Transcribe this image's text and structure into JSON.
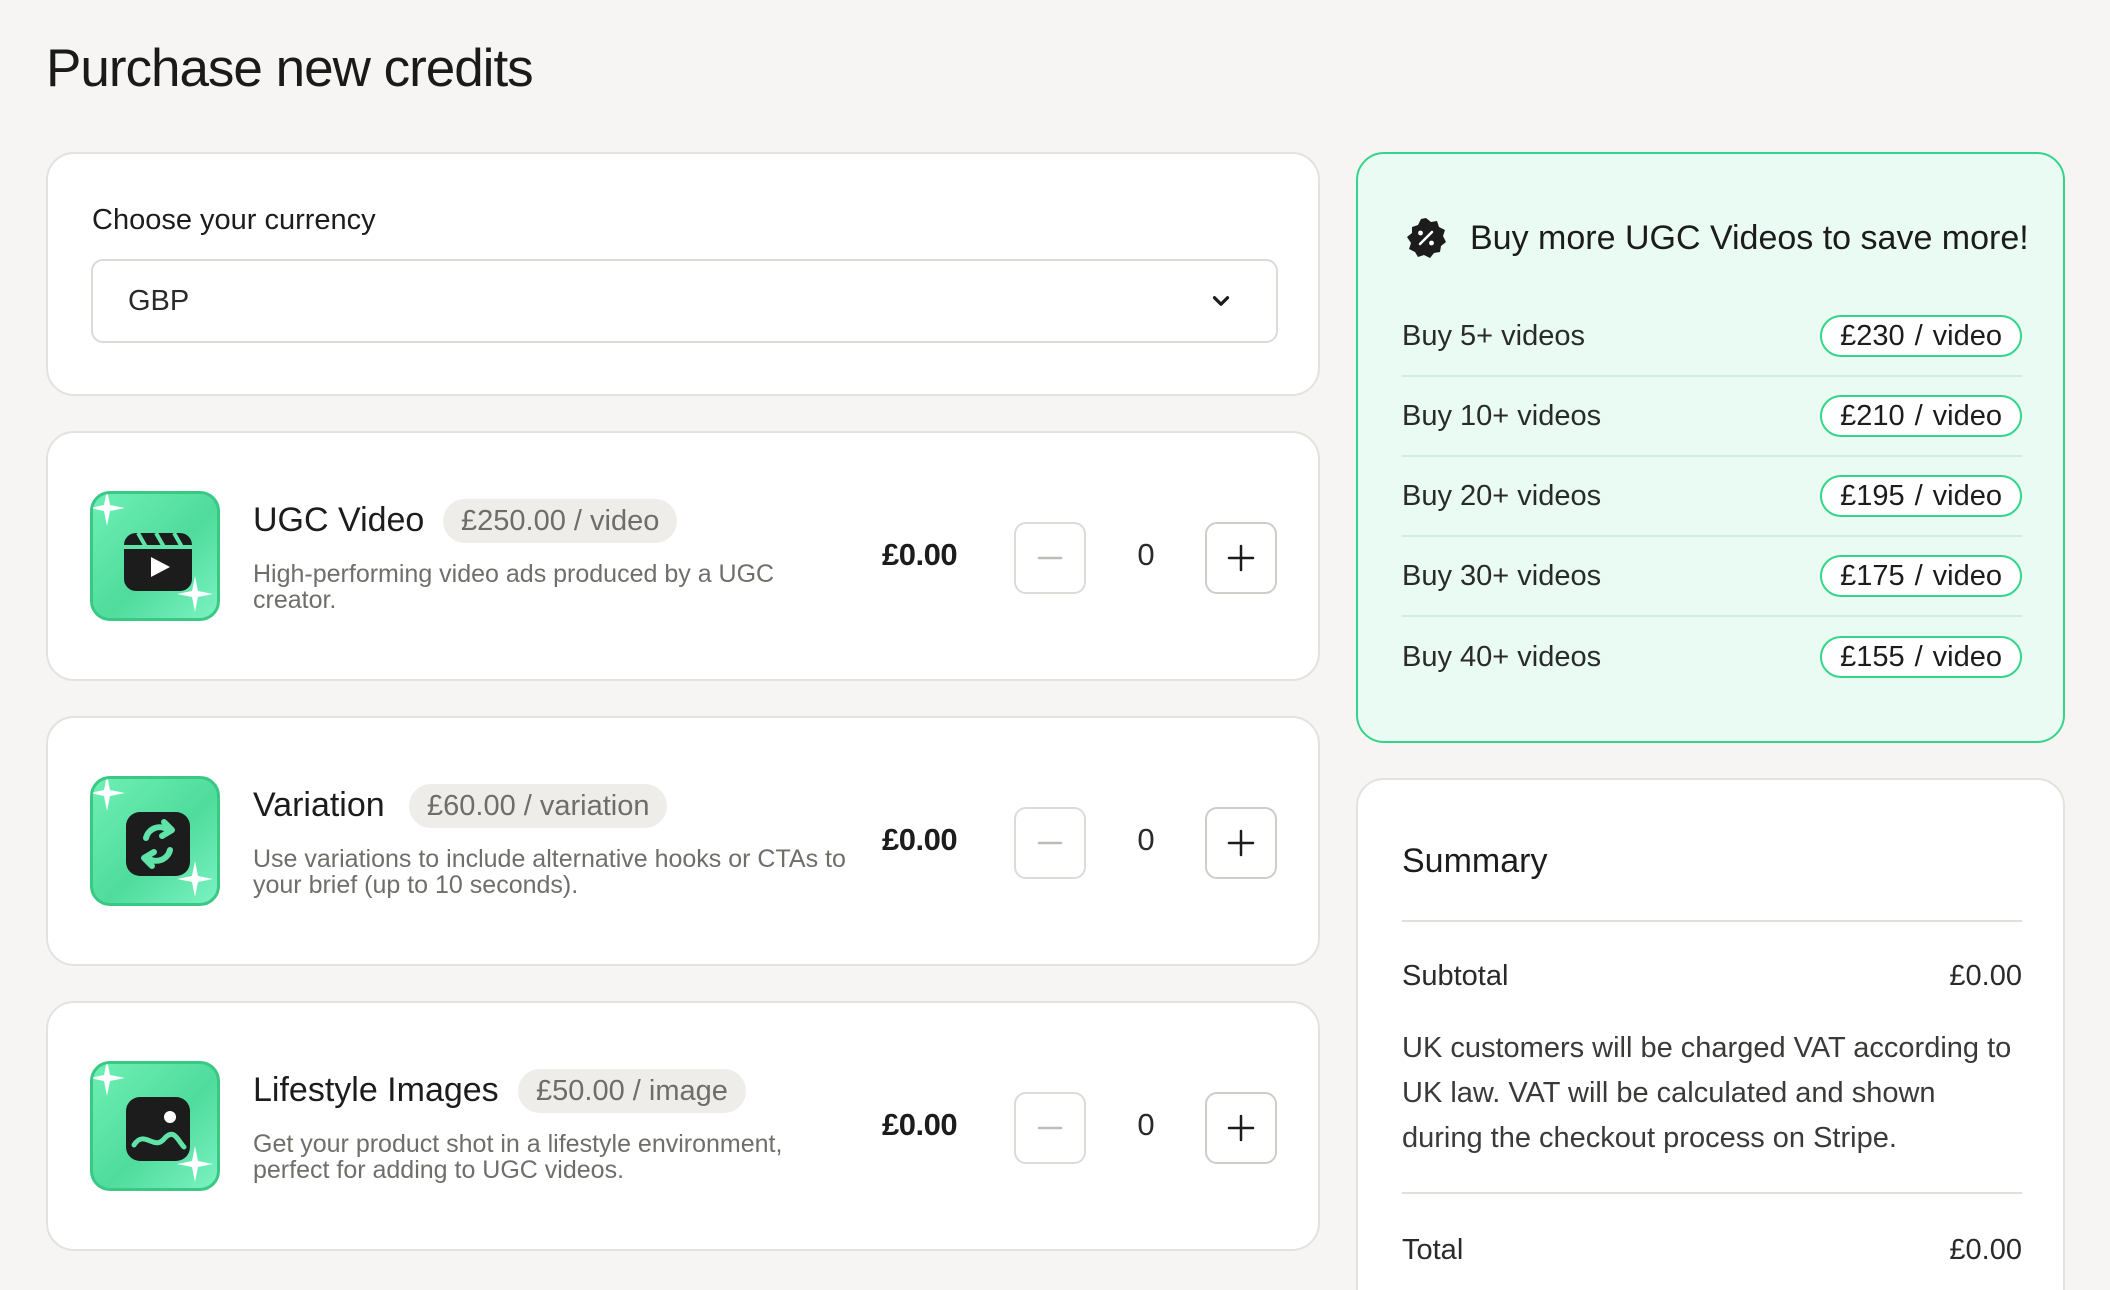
{
  "page": {
    "title": "Purchase new credits"
  },
  "currency": {
    "label": "Choose your currency",
    "selected": "GBP"
  },
  "products": [
    {
      "name": "UGC Video",
      "unit_price": "£250.00 / video",
      "description": "High-performing video ads produced by a UGC creator.",
      "total": "£0.00",
      "quantity": "0",
      "icon": "clapperboard-icon"
    },
    {
      "name": "Variation",
      "unit_price": "£60.00 / variation",
      "description": "Use variations to include alternative hooks or CTAs to your brief (up to 10 seconds).",
      "total": "£0.00",
      "quantity": "0",
      "icon": "repeat-arrows-icon"
    },
    {
      "name": "Lifestyle Images",
      "unit_price": "£50.00 / image",
      "description": "Get your product shot in a lifestyle environment, perfect for adding to UGC videos.",
      "total": "£0.00",
      "quantity": "0",
      "icon": "image-icon"
    }
  ],
  "promo": {
    "title": "Buy more UGC Videos to save more!",
    "tiers": [
      {
        "label": "Buy 5+ videos",
        "price": "£230",
        "unit": "video"
      },
      {
        "label": "Buy 10+ videos",
        "price": "£210",
        "unit": "video"
      },
      {
        "label": "Buy 20+ videos",
        "price": "£195",
        "unit": "video"
      },
      {
        "label": "Buy 30+ videos",
        "price": "£175",
        "unit": "video"
      },
      {
        "label": "Buy 40+ videos",
        "price": "£155",
        "unit": "video"
      }
    ]
  },
  "summary": {
    "title": "Summary",
    "subtotal_label": "Subtotal",
    "subtotal_value": "£0.00",
    "vat_note": "UK customers will be charged VAT according to UK law. VAT will be calculated and shown during the checkout process on Stripe.",
    "total_label": "Total",
    "total_value": "£0.00"
  },
  "colors": {
    "accent": "#34d58a",
    "promo_bg": "#e9fbf2",
    "page_bg": "#f6f5f3"
  }
}
